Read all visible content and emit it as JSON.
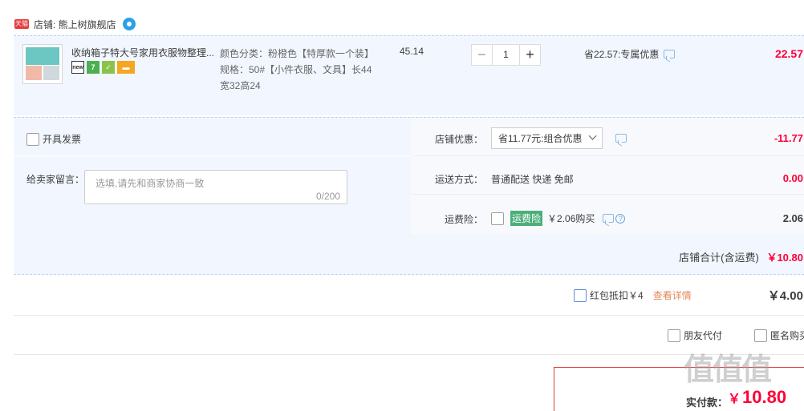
{
  "shop": {
    "badge": "天猫",
    "label": "店铺: 熊上树旗舰店"
  },
  "item": {
    "title": "收纳箱子特大号家用衣服物整理...",
    "sku_color": "颜色分类：粉橙色【特厚款一个装】",
    "sku_size": "规格：50#【小件衣服、文具】长44宽32高24",
    "price": "45.14",
    "quantity": "1",
    "promo": "省22.57:专属优惠",
    "total": "22.57",
    "service_icons": [
      "new-badge-icon",
      "seven-day-return-icon",
      "guarantee-icon",
      "card-icon"
    ]
  },
  "options": {
    "invoice_label": "开具发票",
    "message_label": "给卖家留言：",
    "message_placeholder": "选填,请先和商家协商一致",
    "message_count": "0/200",
    "shop_discount_label": "店铺优惠：",
    "shop_discount_value": "省11.77元:组合优惠",
    "shop_discount_amount": "-11.77",
    "shipping_label": "运送方式：",
    "shipping_value": "普通配送 快递 免邮",
    "shipping_amount": "0.00",
    "insurance_label": "运费险：",
    "insurance_tag": "运费险",
    "insurance_value": "￥2.06购买",
    "insurance_amount": "2.06",
    "shop_total_label": "店铺合计(含运费)",
    "shop_total_value": "￥10.80"
  },
  "redpack": {
    "label": "红包抵扣￥4",
    "detail": "查看详情",
    "amount": "￥4.00"
  },
  "payment_options": {
    "friend_pay": "朋友代付",
    "anonymous": "匿名购买"
  },
  "final": {
    "label": "实付款：",
    "yen": "￥",
    "value": "10.80"
  },
  "watermark": "值值值",
  "colors": {
    "accent_red": "#ff0036",
    "row_bg": "#f2f7ff",
    "insurance_green": "#4caf7a"
  }
}
